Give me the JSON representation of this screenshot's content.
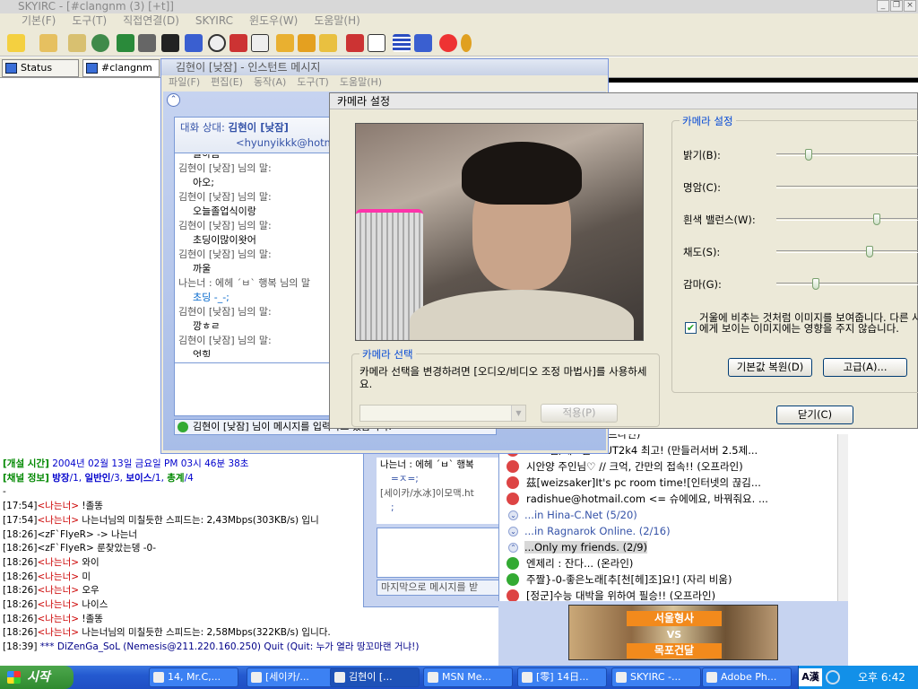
{
  "app": {
    "title": "SKYIRC - [#clangnm (3) [+t]]",
    "menu": [
      "기본(F)",
      "도구(T)",
      "직접연결(D)",
      "SKYIRC",
      "윈도우(W)",
      "도움말(H)"
    ],
    "tabs": [
      "Status",
      "#clangnm"
    ]
  },
  "im": {
    "title": "김현이 [낮잠] - 인스턴트 메시지",
    "menu": [
      "파일(F)",
      "편집(E)",
      "동작(A)",
      "도구(T)",
      "도움말(H)"
    ],
    "partner_label": "대화 상대:",
    "partner_name": "김현이 [낮잠]",
    "partner_email": "<hyunyikkk@hotm",
    "messages": [
      {
        "who": "",
        "text": "놀하음",
        "cut": true
      },
      {
        "who": "김현이 [낮잠] 님의 말:",
        "text": "아오;"
      },
      {
        "who": "김현이 [낮잠] 님의 말:",
        "text": "오늘졸업식이랑"
      },
      {
        "who": "김현이 [낮잠] 님의 말:",
        "text": "초딩이많이왓어"
      },
      {
        "who": "김현이 [낮잠] 님의 말:",
        "text": "까울"
      },
      {
        "who": "나는너 : 에헤 ´ㅂ` 행복 님의 말",
        "text": "초딩 -_-;"
      },
      {
        "who": "김현이 [낮잠] 님의 말:",
        "text": "깡ㅎㄹ"
      },
      {
        "who": "김현이 [낮잠] 님의 말:",
        "text": "엇힝"
      }
    ],
    "status": "김현이 [낮잠] 님이 메시지를 입력하고 있습니다."
  },
  "im2": {
    "messages": [
      "나는너 : 에헤 ´ㅂ` 행복",
      "=ㅈ=;",
      "[세이카/水冰]이모맥.ht",
      ";"
    ],
    "status": "마지막으로 메시지를 받"
  },
  "camera": {
    "title": "카메라 설정",
    "group_settings": "카메라 설정",
    "sliders": [
      {
        "label": "밝기(B):",
        "value": 0.18
      },
      {
        "label": "명암(C):",
        "value": null
      },
      {
        "label": "흰색 밸런스(W):",
        "value": 0.56
      },
      {
        "label": "채도(S):",
        "value": 0.52
      },
      {
        "label": "감마(G):",
        "value": 0.22
      }
    ],
    "mirror_checkbox": "거울에 비추는 것처럼 이미지를 보여줍니다. 다른 사람에게 보이는 이미지에는 영향을 주지 않습니다.",
    "mirror_checked": true,
    "reset_button": "기본값 복원(D)",
    "advanced_button": "고급(A)...",
    "close_button": "닫기(C)",
    "group_select": "카메라 선택",
    "select_desc": "카메라 선택을 변경하려면 [오디오/비디오 조정 마법사]를 사용하세요.",
    "apply_button": "적용(P)"
  },
  "channel": {
    "created_label": "[개설 시간]",
    "created": "2004년 02월 13일 금요일 PM 03시 46분 38초",
    "info_label": "[채널 정보]",
    "info_parts": [
      {
        "k": "방장",
        "v": "/1, "
      },
      {
        "k": "일반인",
        "v": "/3, "
      },
      {
        "k": "보이스",
        "v": "/1, "
      },
      {
        "k": "총계",
        "v": "/4"
      }
    ],
    "lines": [
      {
        "t": "-",
        "nick": "",
        "msg": "",
        "style": ""
      },
      {
        "t": "[17:54]",
        "nick": "<나는너>",
        "msg": " !졸똥",
        "style": "red"
      },
      {
        "t": "[17:54]",
        "nick": "<나는너>",
        "msg": " 나는너님의 미칠듯한 스피드는: 2,43Mbps(303KB/s) 입니",
        "style": "red"
      },
      {
        "t": "[18:26]",
        "nick": "<zF`FlyeR>",
        "msg": " -> 나는너",
        "style": "plain"
      },
      {
        "t": "[18:26]",
        "nick": "<zF`FlyeR>",
        "msg": " 룬찾았는뎅 -0-",
        "style": "plain"
      },
      {
        "t": "[18:26]",
        "nick": "<나는너>",
        "msg": " 와이",
        "style": "red"
      },
      {
        "t": "[18:26]",
        "nick": "<나는너>",
        "msg": " 미",
        "style": "red"
      },
      {
        "t": "[18:26]",
        "nick": "<나는너>",
        "msg": " 오우",
        "style": "red"
      },
      {
        "t": "[18:26]",
        "nick": "<나는너>",
        "msg": " 나이스",
        "style": "red"
      },
      {
        "t": "[18:26]",
        "nick": "<나는너>",
        "msg": " !졸똥",
        "style": "red"
      },
      {
        "t": "[18:26]",
        "nick": "<나는너>",
        "msg": " 나는너님의 미칠듯한 스피드는: 2,58Mbps(322KB/s) 입니다.",
        "style": "red"
      },
      {
        "t": "[18:39]",
        "nick": "",
        "msg": " *** DiZenGa_SoL (Nemesis@211.220.160.250) Quit (Quit: 누가 열라 땅꼬마랜 거냐!)",
        "style": "quit"
      }
    ]
  },
  "contacts": {
    "rows": [
      {
        "type": "contact",
        "status": "red",
        "text": "[저ㅎ우ㅎ우ㅎ] (오프라인)",
        "cut": true
      },
      {
        "type": "contact",
        "status": "red",
        "text": "♣. N군/재모군 :: UT2k4 최고! (만들러서버 2.5제..."
      },
      {
        "type": "contact",
        "status": "red",
        "text": "시안양 주인님♡ // 크억, 간만의 접속!! (오프라인)"
      },
      {
        "type": "contact",
        "status": "red",
        "text": "茲[weizsaker]It's pc room time![인터넷의 끊김..."
      },
      {
        "type": "contact",
        "status": "red",
        "text": "radishue@hotmail.com <= 슈에에요, 바꿔줘요. ..."
      },
      {
        "type": "group",
        "text": "...in Hina-C.Net (5/20)",
        "selected": false
      },
      {
        "type": "group",
        "text": "...in Ragnarok Online. (2/16)",
        "selected": false
      },
      {
        "type": "group",
        "text": "...Only my friends. (2/9)",
        "selected": true
      },
      {
        "type": "contact",
        "status": "green",
        "text": "엔제리 : 잔다... (온라인)"
      },
      {
        "type": "contact",
        "status": "green",
        "text": "주짤}-0-좋은노래[추[천[헤]조]요!] (자리 비움)"
      },
      {
        "type": "contact",
        "status": "red",
        "text": "[정군]수능 대박을 위하여 필승!! (오프라인)"
      }
    ]
  },
  "ad": {
    "line1": "서울형사",
    "line2": "VS",
    "line3": "목포건달"
  },
  "taskbar": {
    "start": "시작",
    "tasks": [
      "14, Mr.C,...",
      "[세이카/...",
      "김현이 [...",
      "MSN Me...",
      "[零] 14日...",
      "SKYIRC -...",
      "Adobe Ph..."
    ],
    "active_index": 2,
    "ime": "A漢",
    "clock": "오후 6:42"
  }
}
